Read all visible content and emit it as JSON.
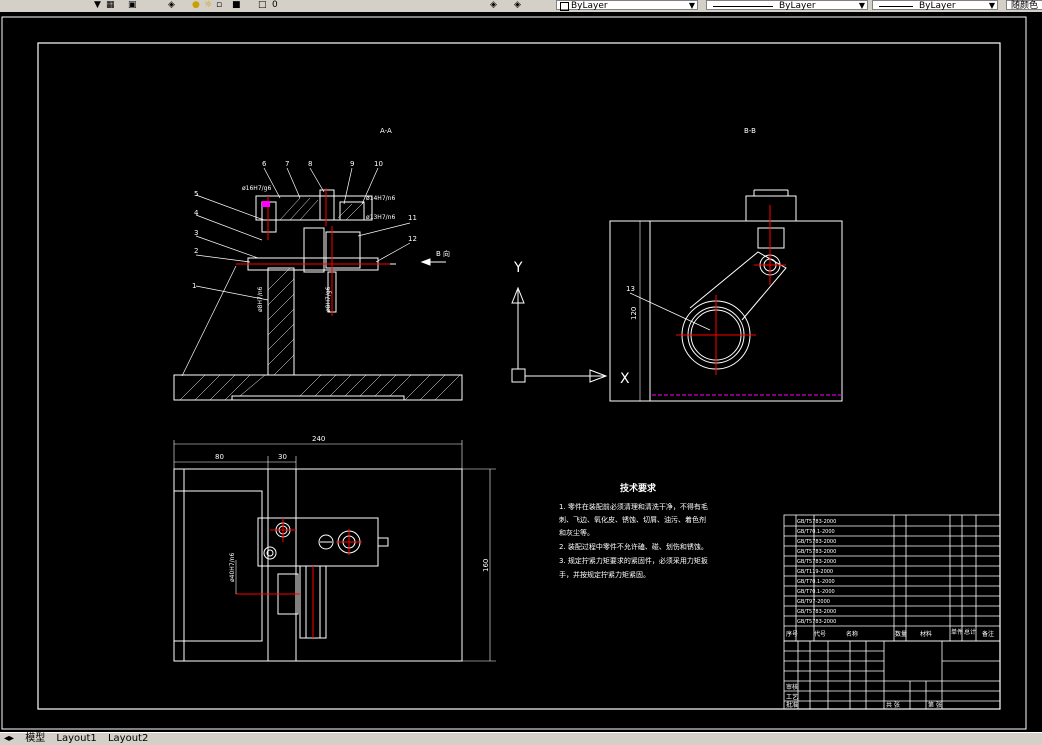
{
  "toolbar": {
    "layer_value": "0",
    "color_combo": "ByLayer",
    "linetype_combo": "ByLayer",
    "lineweight_combo": "ByLayer",
    "plotstyle_combo": "随颜色"
  },
  "tabs": {
    "model": "模型",
    "layout1": "Layout1",
    "layout2": "Layout2"
  },
  "drawing": {
    "section_aa_label": "A-A",
    "section_bb_label": "B-B",
    "view_direction_label": "B 向",
    "fit_note_1": "ø16H7/g6",
    "fit_note_2": "ø14H7/n6",
    "fit_note_3": "ø13H7/n6",
    "fit_note_4": "ø8H7/n6",
    "fit_note_5": "ø8H7/g6",
    "fit_note_6": "ø40H7/n6",
    "callouts": [
      "1",
      "2",
      "3",
      "4",
      "5",
      "6",
      "7",
      "8",
      "9",
      "10",
      "11",
      "12",
      "13"
    ],
    "dim_overall_width": "240",
    "dim_left_1": "80",
    "dim_left_2": "30",
    "dim_height": "160",
    "dim_bb_height": "120",
    "ucs_y": "Y",
    "ucs_x": "X",
    "tech_title": "技术要求",
    "tech_lines": [
      "1. 零件在装配前必须清理和清洗干净，不得有毛",
      "刺、飞边、氧化皮、锈蚀、切屑、油污、着色剂",
      "和灰尘等。",
      "2. 装配过程中零件不允许磕、碰、划伤和锈蚀。",
      "3. 规定拧紧力矩要求的紧固件，必须采用力矩扳",
      "手，并按规定拧紧力矩紧固。"
    ]
  },
  "title_block": {
    "header": [
      "序号",
      "代号",
      "名称",
      "数量",
      "材料",
      "单件",
      "总计",
      "备注"
    ],
    "rows": [
      "GB/T5783-2000",
      "GB/T70.1-2000",
      "GB/T5783-2000",
      "GB/T5783-2000",
      "GB/T5783-2000",
      "GB/T119-2000",
      "GB/T70.1-2000",
      "GB/T70.1-2000",
      "GB/T97-2000",
      "GB/T5783-2000",
      "GB/T5783-2000",
      "GB/T5783-2000"
    ],
    "row_labels": [
      "审核",
      "工艺",
      "批准"
    ],
    "bottom_labels": [
      "共 张",
      "第 张"
    ]
  },
  "colors": {
    "background": "#000000",
    "line": "#ffffff",
    "red": "#ff0000",
    "magenta": "#ff00ff"
  }
}
